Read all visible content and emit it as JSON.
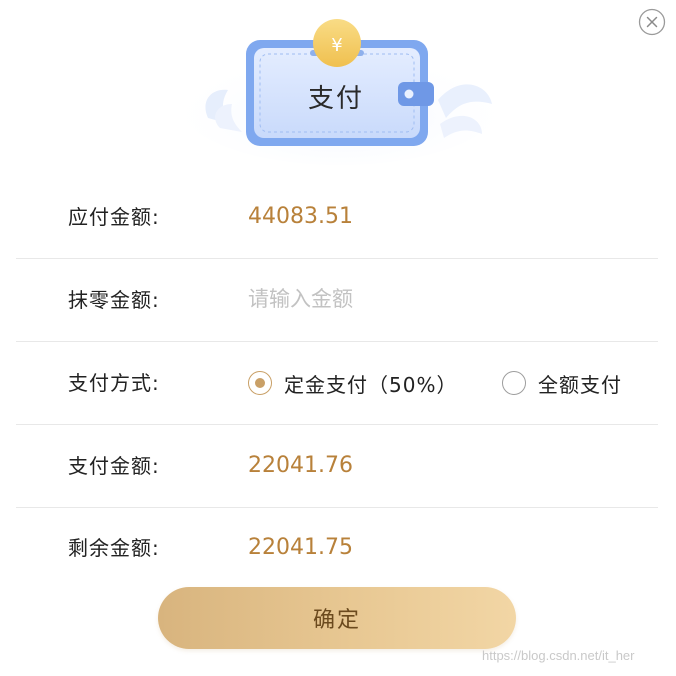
{
  "header": {
    "wallet_title": "支付",
    "coin_symbol": "¥"
  },
  "rows": {
    "payable": {
      "label": "应付金额:",
      "value": "44083.51"
    },
    "round_off": {
      "label": "抹零金额:",
      "placeholder": "请输入金额",
      "value": ""
    },
    "pay_method": {
      "label": "支付方式:",
      "options": [
        {
          "label": "定金支付（50%）",
          "selected": true
        },
        {
          "label": "全额支付",
          "selected": false
        }
      ]
    },
    "pay_amount": {
      "label": "支付金额:",
      "value": "22041.76"
    },
    "remaining": {
      "label": "剩余金额:",
      "value": "22041.75"
    }
  },
  "confirm_label": "确定",
  "watermark": "https://blog.csdn.net/it_her",
  "colors": {
    "accent_gold": "#b8813a",
    "radio_gold": "#c9a067",
    "wallet_blue": "#7fa8ef",
    "button_gradient_start": "#d8b47e",
    "button_gradient_end": "#f2d6a5"
  },
  "icons": {
    "close": "close-circle-icon",
    "wallet": "wallet-icon",
    "coin": "yen-coin-icon"
  }
}
